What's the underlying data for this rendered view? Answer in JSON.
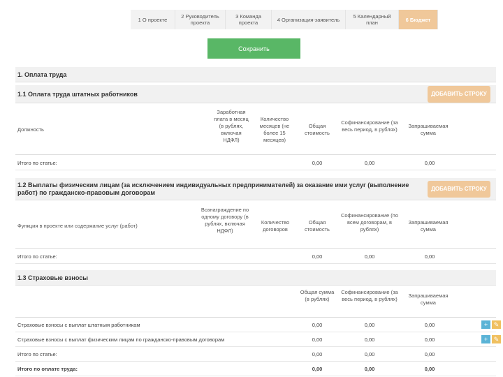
{
  "tabs": [
    {
      "label": "1 О проекте",
      "active": false
    },
    {
      "label": "2 Руководитель проекта",
      "active": false
    },
    {
      "label": "3 Команда проекта",
      "active": false
    },
    {
      "label": "4 Организация-заявитель",
      "active": false
    },
    {
      "label": "5 Календарный план",
      "active": false
    },
    {
      "label": "6 Бюджет",
      "active": true
    }
  ],
  "save_label": "Сохранить",
  "section1": {
    "title": "1. Оплата труда"
  },
  "s11": {
    "title": "1.1 Оплата труда штатных работников",
    "add_label": "ДОБАВИТЬ СТРОКУ",
    "headers": [
      "Должность",
      "Заработная плата в месяц (в рублях, включая НДФЛ)",
      "Количество месяцев (не более 15 месяцев)",
      "Общая стоимость",
      "Софинансирование (за весь период, в рублях)",
      "Запрашиваемая сумма"
    ],
    "total_label": "Итого по статье:",
    "total": [
      "0,00",
      "0,00",
      "0,00"
    ]
  },
  "s12": {
    "title": "1.2 Выплаты физическим лицам (за исключением индивидуальных предпринимателей) за оказание ими услуг (выполнение работ) по гражданско-правовым договорам",
    "add_label": "ДОБАВИТЬ СТРОКУ",
    "headers": [
      "Функция в проекте или содержание услуг (работ)",
      "Вознаграждение по одному договору (в рублях, включая НДФЛ)",
      "Количество договоров",
      "Общая стоимость",
      "Софинансирование (по всем договорам, в рублях)",
      "Запрашиваемая сумма"
    ],
    "total_label": "Итого по статье:",
    "total": [
      "0,00",
      "0,00",
      "0,00"
    ]
  },
  "s13": {
    "title": "1.3 Страховые взносы",
    "headers": [
      "Общая сумма (в рублях)",
      "Софинансирование (за весь период, в рублях)",
      "Запрашиваемая сумма"
    ],
    "rows": [
      {
        "label": "Страховые взносы с выплат штатным работникам",
        "values": [
          "0,00",
          "0,00",
          "0,00"
        ]
      },
      {
        "label": "Страховые взносы с выплат физическим лицам по гражданско-правовым договорам",
        "values": [
          "0,00",
          "0,00",
          "0,00"
        ]
      }
    ],
    "total_label": "Итого по статье:",
    "total": [
      "0,00",
      "0,00",
      "0,00"
    ],
    "grand_label": "Итого по оплате труда:",
    "grand": [
      "0,00",
      "0,00",
      "0,00"
    ]
  },
  "icons": {
    "add": "plus-icon",
    "edit": "pencil-icon"
  },
  "colors": {
    "accent": "#f0c89a",
    "save": "#59b766",
    "add_icon": "#5ab3d6",
    "edit_icon": "#f0c060"
  }
}
